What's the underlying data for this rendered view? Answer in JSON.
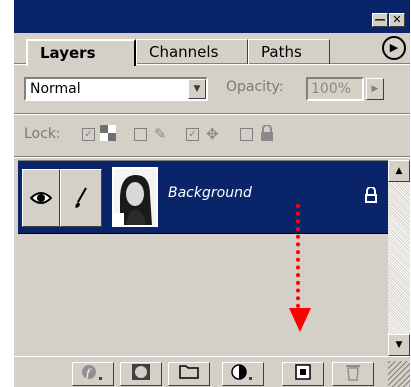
{
  "window": {
    "minimize_glyph": "—",
    "close_glyph": "✕"
  },
  "tabs": [
    {
      "label": "Layers",
      "active": true
    },
    {
      "label": "Channels",
      "active": false
    },
    {
      "label": "Paths",
      "active": false
    }
  ],
  "panel_menu_glyph": "▶",
  "blend": {
    "mode": "Normal",
    "opacity_label": "Opacity:",
    "opacity_value": "100%"
  },
  "lock": {
    "label": "Lock:",
    "options": [
      {
        "icon": "transparency-lock-icon",
        "checked": true
      },
      {
        "icon": "paint-lock-icon",
        "checked": false
      },
      {
        "icon": "move-lock-icon",
        "checked": true
      },
      {
        "icon": "all-lock-icon",
        "checked": false
      }
    ]
  },
  "layers": [
    {
      "name": "Background",
      "visible": true,
      "locked": true,
      "selected": true
    }
  ],
  "footer_buttons": [
    "add-layer-style-icon",
    "add-mask-icon",
    "new-set-icon",
    "new-fill-adjustment-icon",
    "new-layer-icon",
    "trash-icon"
  ],
  "colors": {
    "panel_bg": "#d4d0c8",
    "title_bg": "#0a246a",
    "selection": "#0a246a",
    "annotation_arrow": "#ff0000"
  }
}
